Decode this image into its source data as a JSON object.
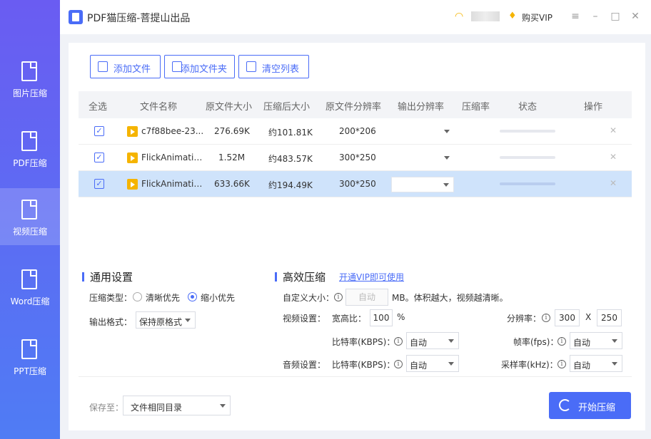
{
  "window": {
    "title": "PDF猫压缩-菩提山出品",
    "vip_label": "购买VIP"
  },
  "sidebar": {
    "items": [
      {
        "label": "图片压缩"
      },
      {
        "label": "PDF压缩"
      },
      {
        "label": "视频压缩"
      },
      {
        "label": "Word压缩"
      },
      {
        "label": "PPT压缩"
      }
    ],
    "active": "视频压缩"
  },
  "toolbar": {
    "add_file": "添加文件",
    "add_folder": "添加文件夹",
    "clear_list": "清空列表"
  },
  "table": {
    "headers": [
      "全选",
      "文件名称",
      "原文件大小",
      "压缩后大小",
      "原文件分辨率",
      "输出分辨率",
      "压缩率",
      "状态",
      "操作"
    ],
    "rows": [
      {
        "name": "c7f88bee-23...",
        "orig_size": "276.69K",
        "comp_size": "约101.81K",
        "orig_res": "200*206",
        "checked": true
      },
      {
        "name": "FlickAnimation.",
        "orig_size": "1.52M",
        "comp_size": "约483.57K",
        "orig_res": "300*250",
        "checked": true
      },
      {
        "name": "FlickAnimatio...",
        "orig_size": "633.66K",
        "comp_size": "约194.49K",
        "orig_res": "300*250",
        "checked": true
      }
    ]
  },
  "general_settings": {
    "title": "通用设置",
    "compress_type_label": "压缩类型：",
    "option_clear": "清晰优先",
    "option_small": "缩小优先",
    "selected": "缩小优先",
    "output_format_label": "输出格式：",
    "output_format_value": "保持原格式"
  },
  "advanced_settings": {
    "title": "高效压缩",
    "vip_link": "开通VIP即可使用",
    "custom_size_label": "自定义大小：",
    "custom_size_value": "自动",
    "custom_size_hint": "MB。体积越大，视频越清晰。",
    "video_label": "视频设置：",
    "aspect_label": "宽高比：",
    "aspect_value": "100",
    "aspect_unit": "%",
    "resolution_label": "分辨率：",
    "res_w": "300",
    "res_x": "X",
    "res_h": "250",
    "bitrate_label": "比特率(KBPS)：",
    "video_bitrate_value": "自动",
    "fps_label": "帧率(fps)：",
    "fps_value": "自动",
    "audio_label": "音频设置：",
    "audio_bitrate_value": "自动",
    "sample_label": "采样率(kHz)：",
    "sample_value": "自动"
  },
  "footer": {
    "save_to_label": "保存至：",
    "save_to_value": "文件相同目录",
    "start_label": "开始压缩"
  }
}
